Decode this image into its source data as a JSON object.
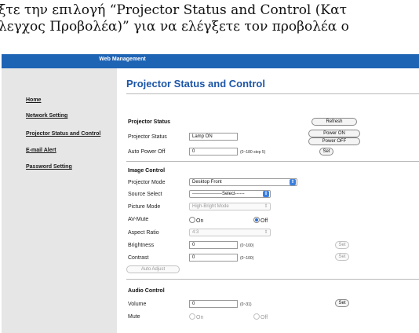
{
  "instruction": {
    "line1": "ξτε την επιλογή “Projector Status and Control (Κατ",
    "line2": "λεγχος Προβολέα)” για να ελέγξετε τον προβολέα ο"
  },
  "header": {
    "title": "Web Management",
    "bar_color": "#1e64b5"
  },
  "sidebar": {
    "items": [
      {
        "label": "Home"
      },
      {
        "label": "Network Setting"
      },
      {
        "label": "Projector Status and Control"
      },
      {
        "label": "E-mail Alert"
      },
      {
        "label": "Password Setting"
      }
    ]
  },
  "main": {
    "title": "Projector Status and Control",
    "projector_status": {
      "heading": "Projector Status",
      "refresh_label": "Refresh",
      "status_label": "Projector Status",
      "status_value": "Lamp ON",
      "power_on_label": "Power ON",
      "power_off_label": "Power OFF",
      "auto_power_off_label": "Auto Power Off",
      "auto_power_off_value": "0",
      "auto_power_off_hint": "(0~180 step 5)",
      "set_label": "Set"
    },
    "image_control": {
      "heading": "Image Control",
      "projector_mode_label": "Projector Mode",
      "projector_mode_value": "Desktop Front",
      "source_select_label": "Source Select",
      "source_select_value": "-------------------Select------",
      "picture_mode_label": "Picture Mode",
      "picture_mode_value": "High-Bright Mode",
      "av_mute_label": "AV-Mute",
      "av_mute_on": "On",
      "av_mute_off": "Off",
      "av_mute_selected": "Off",
      "aspect_ratio_label": "Aspect Ratio",
      "aspect_ratio_value": "4:3",
      "brightness_label": "Brightness",
      "brightness_value": "0",
      "brightness_hint": "(0~100)",
      "contrast_label": "Contrast",
      "contrast_value": "0",
      "contrast_hint": "(0~100)",
      "set_label": "Set",
      "auto_adjust_label": "Auto Adjust"
    },
    "audio_control": {
      "heading": "Audio Control",
      "volume_label": "Volume",
      "volume_value": "0",
      "volume_hint": "(0~31)",
      "set_label": "Set",
      "mute_label": "Mute",
      "mute_on": "On",
      "mute_off": "Off",
      "mute_selected": "Off"
    }
  }
}
